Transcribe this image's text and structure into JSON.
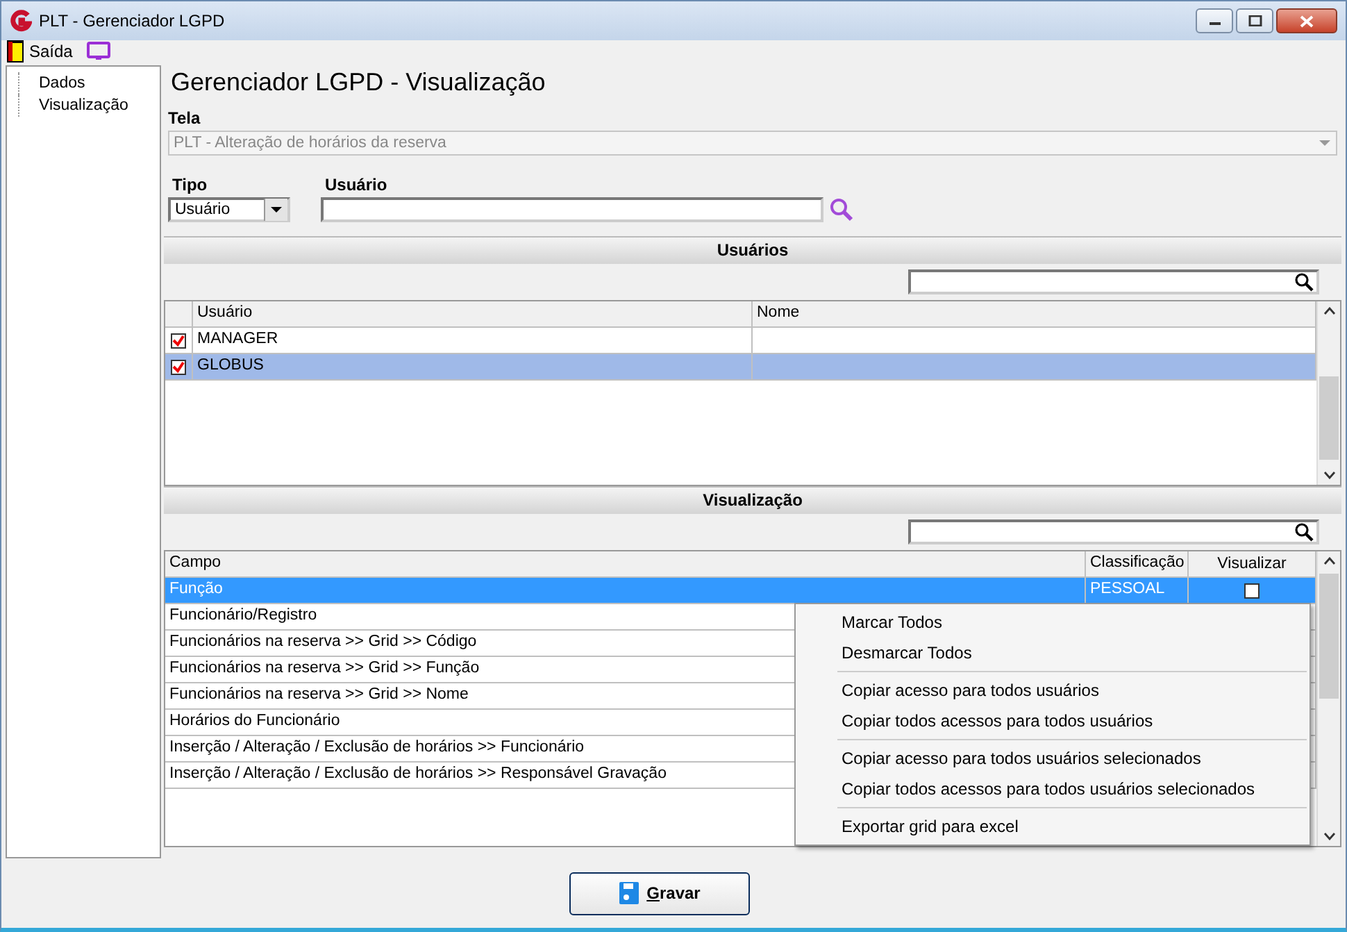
{
  "window": {
    "title": "PLT - Gerenciador LGPD"
  },
  "toolbar": {
    "exit_label": "Saída"
  },
  "sidebar": {
    "items": [
      {
        "label": "Dados",
        "selected": false
      },
      {
        "label": "Visualização",
        "selected": false
      }
    ]
  },
  "page_title": "Gerenciador LGPD - Visualização",
  "tela": {
    "label": "Tela",
    "value": "PLT - Alteração de horários da reserva",
    "disabled": true
  },
  "tipo": {
    "label": "Tipo",
    "value": "Usuário"
  },
  "usuario": {
    "label": "Usuário"
  },
  "users_section": {
    "title": "Usuários",
    "columns": [
      "Usuário",
      "Nome"
    ],
    "rows": [
      {
        "checked": true,
        "usuario": "MANAGER",
        "selected": false
      },
      {
        "checked": true,
        "usuario": "GLOBUS",
        "selected": true
      }
    ]
  },
  "view_section": {
    "title": "Visualização",
    "columns": [
      "Campo",
      "Classificação",
      "Visualizar"
    ],
    "rows": [
      {
        "campo": "Função",
        "classificacao": "PESSOAL",
        "visualizar": false,
        "selected": true
      },
      {
        "campo": "Funcionário/Registro",
        "selected": false
      },
      {
        "campo": "Funcionários na reserva >> Grid >> Código",
        "selected": false
      },
      {
        "campo": "Funcionários na reserva >> Grid >> Função",
        "selected": false
      },
      {
        "campo": "Funcionários na reserva >> Grid >> Nome",
        "selected": false
      },
      {
        "campo": "Horários do Funcionário",
        "selected": false
      },
      {
        "campo": "Inserção / Alteração / Exclusão de horários >> Funcionário",
        "selected": false
      },
      {
        "campo": "Inserção / Alteração / Exclusão de horários >> Responsável Gravação",
        "selected": false
      }
    ]
  },
  "context_menu": {
    "groups": [
      [
        "Marcar Todos",
        "Desmarcar Todos"
      ],
      [
        "Copiar acesso para todos usuários",
        "Copiar todos acessos para todos usuários"
      ],
      [
        "Copiar acesso para todos usuários selecionados",
        "Copiar todos acessos para todos usuários selecionados"
      ],
      [
        "Exportar grid para excel"
      ]
    ]
  },
  "save_button": {
    "label": "Gravar"
  }
}
